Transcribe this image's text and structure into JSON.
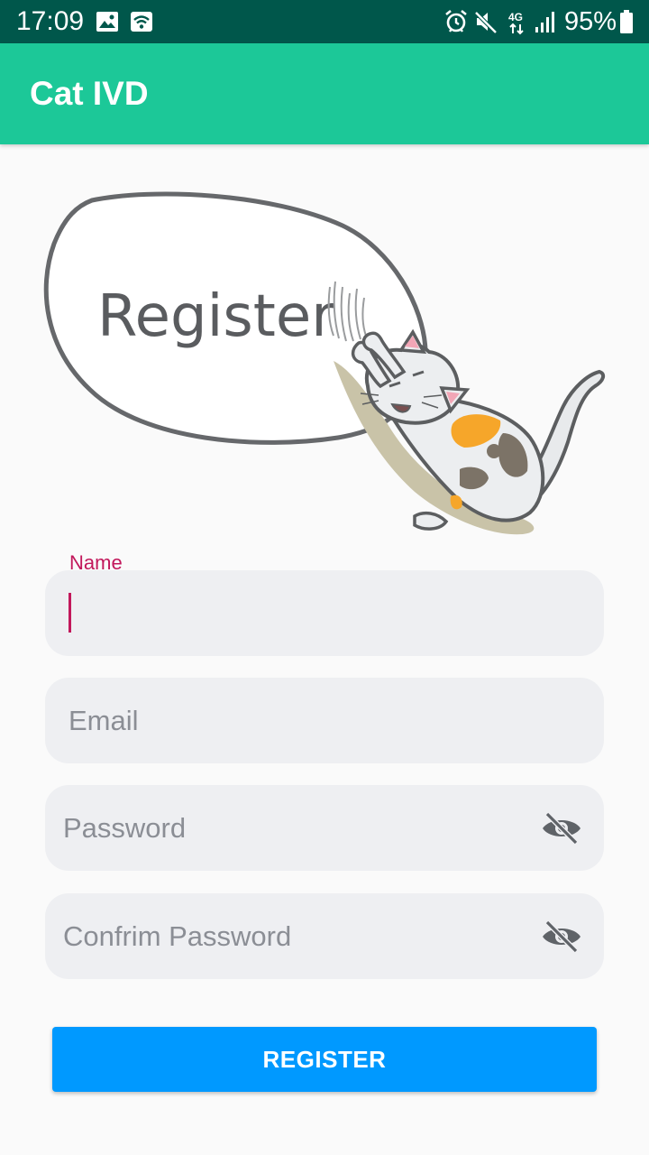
{
  "status_bar": {
    "time": "17:09",
    "battery": "95%",
    "network": "4G",
    "icons": [
      "image-icon",
      "wifi-icon",
      "alarm-icon",
      "mute-icon",
      "network-4g-icon",
      "signal-icon",
      "battery-icon"
    ]
  },
  "app_bar": {
    "title": "Cat IVD"
  },
  "illustration": {
    "bubble_text": "Register"
  },
  "form": {
    "name": {
      "label": "Name",
      "value": ""
    },
    "email": {
      "placeholder": "Email"
    },
    "password": {
      "placeholder": "Password",
      "icon": "visibility-off-icon"
    },
    "confirm_password": {
      "placeholder": "Confrim Password",
      "icon": "visibility-off-icon"
    }
  },
  "register_button": {
    "label": "REGISTER"
  },
  "colors": {
    "status_bar": "#00574b",
    "app_bar": "#1cc898",
    "accent": "#c2185b",
    "button": "#0099ff",
    "field_bg": "#eeeff2"
  }
}
